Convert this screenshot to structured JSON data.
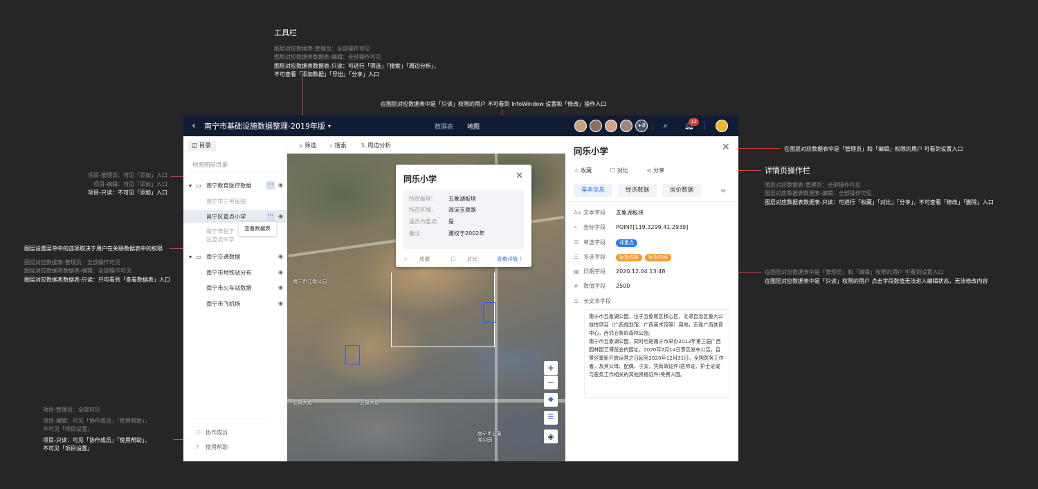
{
  "annotations": {
    "toolbar": {
      "title": "工具栏",
      "lines": [
        "图层对应数据表-管理员：全部操作可见",
        "图层对应数据表数据表-编辑：全部操作可见"
      ],
      "highlight": [
        "图层对应数据表数据表-只读：可进行「筛选」「搜索」「周边分析」，",
        "不可查看「添加数据」「导出」「分享」入口"
      ]
    },
    "infowindow": "在图层对应数据表中是「只读」权限的用户 不可看到 InfoWindow 设置和「修改」操作入口",
    "project_add": {
      "lines": [
        "项目-管理员：可见「添加」入口",
        "项目-编辑：可见「添加」入口"
      ],
      "highlight": "项目-只读：不可见「添加」入口"
    },
    "layer_menu": {
      "title": "图层设置菜单中的选项取决于用户在关联数据表中的权限",
      "lines": [
        "图层对应数据表-管理员：全部操作可见",
        "图层对应数据表数据表-编辑：全部操作可见"
      ],
      "highlight": "图层对应数据表数据表-只读：只可看到「查看数据表」入口"
    },
    "project_footer": {
      "lines": [
        "项目-管理员：全部可见",
        "项目-编辑：可见「协作成员」「使用帮助」，",
        "不可见「项目设置」"
      ],
      "highlight": [
        "项目-只读：可见「协作成员」「使用帮助」，",
        "不可见「项目设置」"
      ]
    },
    "settings_entry": "在图层对应数据表中是「管理员」和「编辑」权限的用户 可看到设置入口",
    "detail_actions": {
      "title": "详情页操作栏",
      "lines": [
        "图层对应数据表-管理员：全部操作可见",
        "图层对应数据表数据表-编辑：全部操作可见"
      ],
      "highlight": "图层对应数据表数据表-只读：可进行「收藏」「对比」「分享」，不可查看「修改」「删除」入口"
    },
    "field_edit": {
      "line": "在图层对应数据表中是「管理员」和「编辑」权限的用户 可看到设置入口",
      "highlight": "在图层对应数据表中是「只读」权限的用户 点击字段数值无法进入编辑状态，无法修改内容"
    }
  },
  "topbar": {
    "back_icon": "chevron-left-icon",
    "title": "南宁市基础设施数据整理-2019年版",
    "views": [
      "数据表",
      "地图"
    ],
    "active_view": "地图",
    "avatar_more": "+8",
    "notify_count": "12"
  },
  "sidebar": {
    "dir_label": "目录",
    "search_placeholder": "地图图层目录",
    "groups": [
      {
        "label": "南宁教育医疗数据"
      },
      {
        "label": "南宁交通数据"
      }
    ],
    "items": {
      "hospital": "南宁市三甲医院",
      "school": "邕宁区重点小学",
      "middle_1": "南宁市邕宁",
      "middle_2": "区重点中学",
      "metro": "南宁市地铁站分布",
      "train": "南宁市火车站数据",
      "airport": "南宁市飞机场"
    },
    "popup_item": "查看数据表",
    "footer": [
      "协作成员",
      "使用帮助"
    ]
  },
  "toolbar": {
    "filter": "筛选",
    "search": "搜索",
    "nearby": "周边分析"
  },
  "map": {
    "labels": [
      "南宁市江南公园",
      "五象大道",
      "五象大道",
      "南宁市五象",
      "湖公园"
    ]
  },
  "infowindow": {
    "title": "同乐小学",
    "rows": [
      {
        "k": "所在板块:",
        "v": "五象湖板块"
      },
      {
        "k": "所在区域:",
        "v": "海淀玉泉路"
      },
      {
        "k": "是否为重点:",
        "v": "是"
      },
      {
        "k": "备注:",
        "v": "建校于2002年"
      }
    ],
    "favorite": "收藏",
    "compare": "对比",
    "detail_link": "查看详情 〉"
  },
  "detail": {
    "title": "同乐小学",
    "actions": [
      "收藏",
      "对比",
      "分享"
    ],
    "tabs": [
      "基本信息",
      "经济数据",
      "房价数据"
    ],
    "fields": {
      "text_k": "文本字段",
      "text_v": "五象湖板块",
      "coord_k": "坐标字段",
      "coord_v": "POINT[119.3299,41.2939]",
      "single_k": "单选字段",
      "single_v": "非重点",
      "multi_k": "多选字段",
      "multi_v1": "标签内容",
      "multi_v2": "标签内容",
      "date_k": "日期字段",
      "date_v": "2020.12.04 13:48",
      "num_k": "数值字段",
      "num_v": "2500",
      "long_k": "长文本字段"
    },
    "long_text_p1": "南宁市五象湖公园，位于五象新区核心区，北邻自治区重大公益性项目（广西规划馆、广西美术馆等）用地，东靠广西体育中心，西邻五象岭森林公园。",
    "long_text_p2": "南宁市五象湖公园，同时也是南宁市举办2013年第三届广西园林园艺博览会的园址。2020年2月14日景区发布公告，自景区重新开放运营之日起至2020年12月31日，全国医务工作者，及其父母、配偶、子女，凭有效证件(医师证、护士证或与医务工作相关的其他资格证件)免费入园。"
  },
  "colors": {
    "topbar": "#0f1c33",
    "accent": "#2f6fe0",
    "annotation_line": "#d94141",
    "tag_blue": "#2f7fe8",
    "tag_orange": "#f39a2c"
  }
}
